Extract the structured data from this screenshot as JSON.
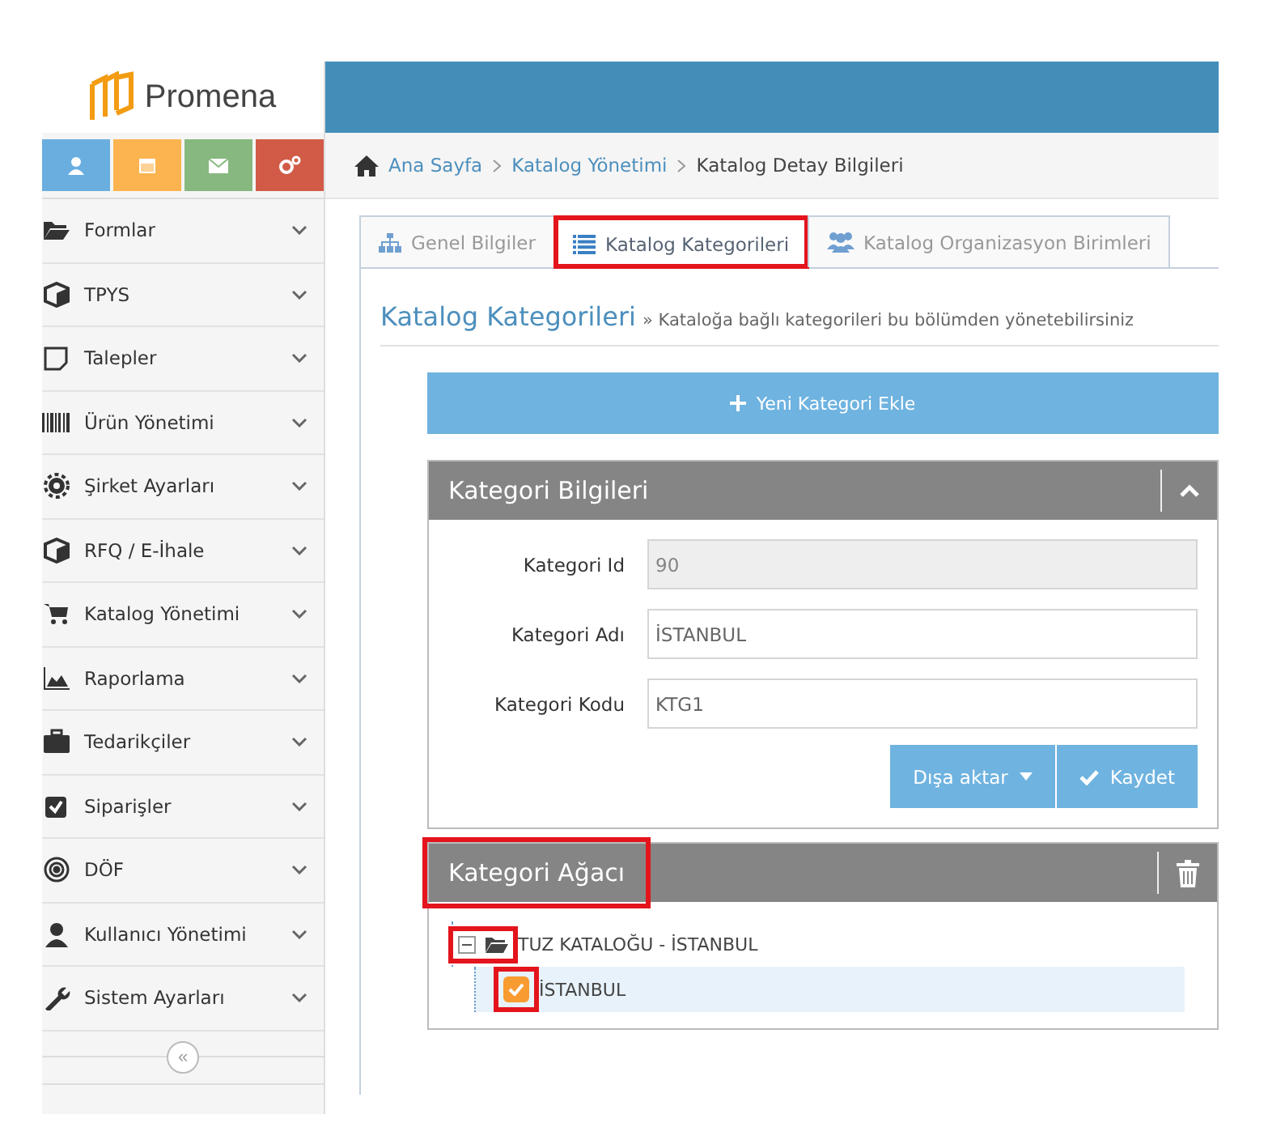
{
  "logo": {
    "text": "Promena"
  },
  "quick_buttons": [
    {
      "color": "#6aaee0"
    },
    {
      "color": "#fbb450"
    },
    {
      "color": "#87b87f"
    },
    {
      "color": "#d15b47"
    }
  ],
  "sidebar": {
    "items": [
      {
        "label": "Formlar",
        "expanded": false
      },
      {
        "label": "TPYS",
        "expanded": false
      },
      {
        "label": "Talepler",
        "expanded": false
      },
      {
        "label": "Ürün Yönetimi",
        "expanded": false
      },
      {
        "label": "Şirket Ayarları",
        "expanded": false
      },
      {
        "label": "RFQ / E-İhale",
        "expanded": false
      },
      {
        "label": "Katalog Yönetimi",
        "expanded": false
      },
      {
        "label": "Raporlama",
        "expanded": false
      },
      {
        "label": "Tedarikçiler",
        "expanded": false
      },
      {
        "label": "Siparişler",
        "expanded": false
      },
      {
        "label": "DÖF",
        "expanded": false
      },
      {
        "label": "Kullanıcı Yönetimi",
        "expanded": false
      },
      {
        "label": "Sistem Ayarları",
        "expanded": false
      }
    ],
    "collapse": "«"
  },
  "breadcrumb": [
    {
      "label": "Ana Sayfa",
      "link": true
    },
    {
      "label": "Katalog Yönetimi",
      "link": true
    },
    {
      "label": "Katalog Detay Bilgileri",
      "link": false
    }
  ],
  "tabs": [
    {
      "label": "Genel Bilgiler",
      "selected": false,
      "highlighted": false
    },
    {
      "label": "Katalog Kategorileri",
      "selected": true,
      "highlighted": true
    },
    {
      "label": "Katalog Organizasyon Birimleri",
      "selected": false,
      "highlighted": false
    }
  ],
  "page_title": "Katalog Kategorileri",
  "page_subtitle": "» Kataloğa bağlı kategorileri bu bölümden yönetebilirsiniz",
  "add_button": "Yeni Kategori Ekle",
  "info_panel": {
    "title": "Kategori Bilgileri",
    "fields": [
      {
        "label": "Kategori Id",
        "value": "90",
        "disabled": true
      },
      {
        "label": "Kategori Adı",
        "value": "İSTANBUL",
        "disabled": false
      },
      {
        "label": "Kategori Kodu",
        "value": "KTG1",
        "disabled": false
      }
    ],
    "export_button": "Dışa aktar",
    "save_button": "Kaydet"
  },
  "tree_panel": {
    "title": "Kategori Ağacı",
    "highlighted": true,
    "tree": [
      {
        "label": "TUZ KATALOĞU - İSTANBUL",
        "expanded": true,
        "highlighted": true,
        "children": [
          {
            "label": "İSTANBUL",
            "checked": true,
            "selected": true,
            "highlighted": true
          }
        ]
      }
    ]
  }
}
